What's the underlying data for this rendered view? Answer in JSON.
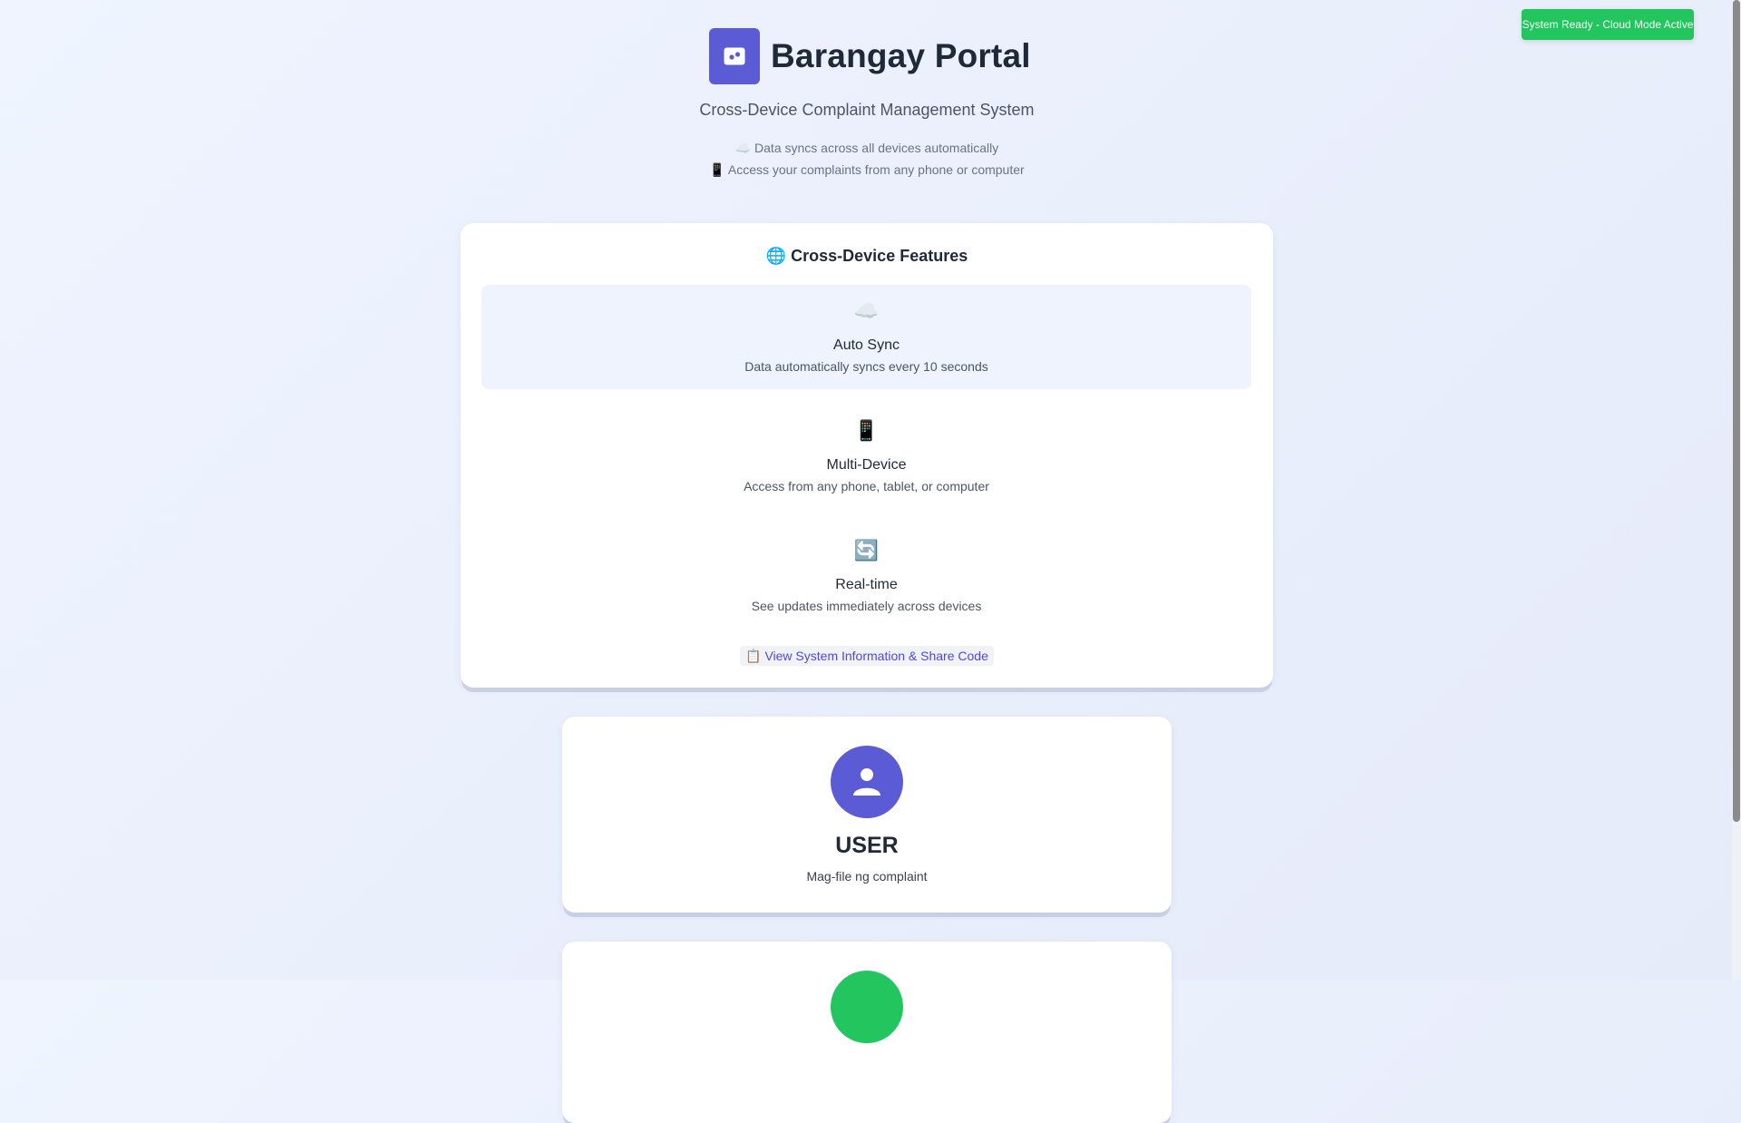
{
  "status": {
    "text": "System Ready - Cloud Mode Active",
    "color": "#22c55e"
  },
  "header": {
    "logo_icon": "message-icon",
    "title": "Barangay Portal",
    "subtitle": "Cross-Device Complaint Management System",
    "notes": [
      "☁️ Data syncs across all devices automatically",
      "📱 Access your complaints from any phone or computer"
    ]
  },
  "features": {
    "title": "🌐 Cross-Device Features",
    "items": [
      {
        "icon": "☁️",
        "icon_name": "cloud-icon",
        "name": "Auto Sync",
        "desc": "Data automatically syncs every 10 seconds"
      },
      {
        "icon": "📱",
        "icon_name": "phone-icon",
        "name": "Multi-Device",
        "desc": "Access from any phone, tablet, or computer"
      },
      {
        "icon": "🔄",
        "icon_name": "refresh-icon",
        "name": "Real-time",
        "desc": "See updates immediately across devices"
      }
    ],
    "link_label": "📋 View System Information & Share Code"
  },
  "roles": [
    {
      "title": "USER",
      "desc": "Mag-file ng complaint",
      "icon": "user-icon",
      "color": "#5b5bd6"
    },
    {
      "icon": "admin-icon",
      "color": "#22c55e"
    }
  ],
  "colors": {
    "accent": "#5b5bd6",
    "success": "#22c55e",
    "link": "#4f46e5"
  }
}
